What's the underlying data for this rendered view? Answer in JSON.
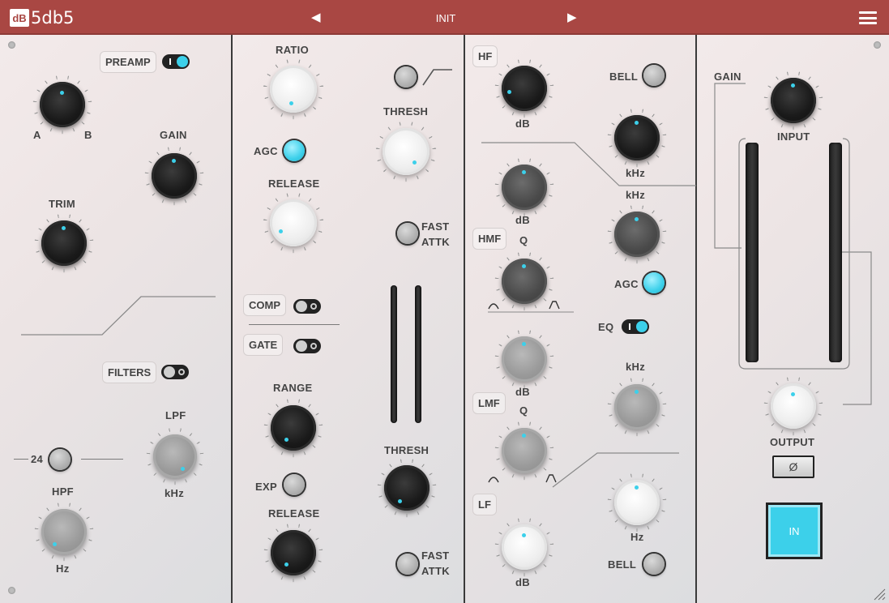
{
  "header": {
    "logo_badge": "dB",
    "logo_text": "5db5",
    "prev_arrow": "◀",
    "next_arrow": "▶",
    "preset": "INIT",
    "menu_icon": "hamburger-menu-icon"
  },
  "accent_color": "#3cd0ea",
  "header_color": "#a94743",
  "preamp": {
    "preamp_label": "PREAMP",
    "preamp_on": true,
    "a_label": "A",
    "b_label": "B",
    "gain_label": "GAIN",
    "trim_label": "TRIM",
    "filters_label": "FILTERS",
    "filters_on": false,
    "slope_value": "24",
    "lpf_label": "LPF",
    "lpf_unit": "kHz",
    "hpf_label": "HPF",
    "hpf_unit": "Hz"
  },
  "dynamics": {
    "ratio_label": "RATIO",
    "thresh_label": "THRESH",
    "agc_label": "AGC",
    "agc_on": true,
    "release_label": "RELEASE",
    "fast_attk_top": "FAST",
    "fast_attk_bottom": "ATTK",
    "comp_label": "COMP",
    "comp_on": false,
    "gate_label": "GATE",
    "gate_on": false,
    "range_label": "RANGE",
    "exp_label": "EXP",
    "gate_release_label": "RELEASE",
    "gate_thresh_label": "THRESH",
    "gate_fast_top": "FAST",
    "gate_fast_bottom": "ATTK"
  },
  "eq": {
    "hf_label": "HF",
    "hf_gain_unit": "dB",
    "bell_label": "BELL",
    "hf_freq_unit": "kHz",
    "hmf_gain_unit": "dB",
    "hmf_freq_unit": "kHz",
    "hmf_label": "HMF",
    "hmf_q_label": "Q",
    "agc_label": "AGC",
    "agc_on": true,
    "eq_label": "EQ",
    "eq_on": true,
    "lmf_gain_unit": "dB",
    "lmf_freq_unit": "kHz",
    "lmf_label": "LMF",
    "lmf_q_label": "Q",
    "lf_label": "LF",
    "lf_gain_unit": "dB",
    "lf_freq_unit": "Hz",
    "lf_bell_label": "BELL"
  },
  "output": {
    "gain_label": "GAIN",
    "input_label": "INPUT",
    "output_label": "OUTPUT",
    "phase_label": "Ø",
    "in_label": "IN"
  }
}
